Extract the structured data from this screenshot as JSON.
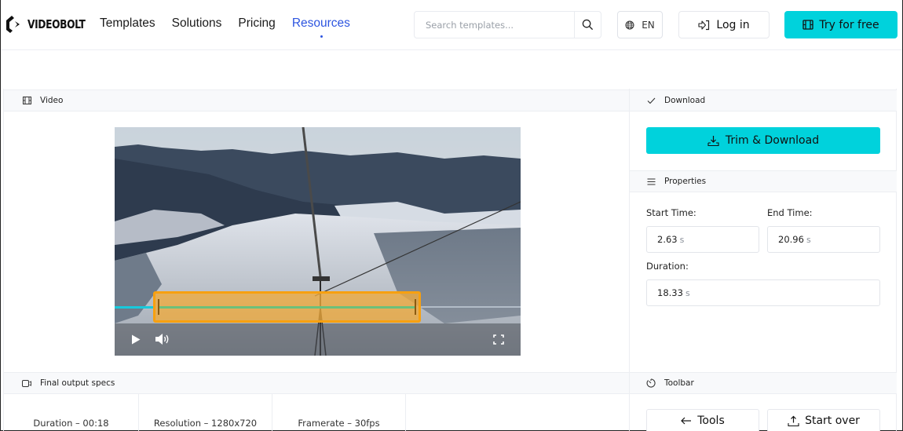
{
  "header": {
    "brand": "VIDEOBOLT",
    "nav": [
      {
        "label": "Templates",
        "active": false
      },
      {
        "label": "Solutions",
        "active": false
      },
      {
        "label": "Pricing",
        "active": false
      },
      {
        "label": "Resources",
        "active": true
      }
    ],
    "search": {
      "placeholder": "Search templates...",
      "value": "",
      "icon": "search-icon"
    },
    "language": {
      "label": "EN",
      "icon": "globe-icon"
    },
    "login": {
      "label": "Log in",
      "icon": "login-icon"
    },
    "try_free": {
      "label": "Try for free",
      "icon": "film-icon"
    }
  },
  "video_panel": {
    "title": "Video",
    "icon": "film-icon",
    "player": {
      "play_icon": "play-icon",
      "volume_icon": "volume-icon",
      "fullscreen_icon": "fullscreen-icon"
    },
    "trim": {
      "start_fraction": 0.095,
      "end_fraction": 0.755
    }
  },
  "download_panel": {
    "title": "Download",
    "icon": "check-icon",
    "button_label": "Trim & Download",
    "button_icon": "download-icon"
  },
  "properties_panel": {
    "title": "Properties",
    "icon": "menu-icon",
    "start_time": {
      "label": "Start Time:",
      "value": "2.63",
      "unit": "s"
    },
    "end_time": {
      "label": "End Time:",
      "value": "20.96",
      "unit": "s"
    },
    "duration": {
      "label": "Duration:",
      "value": "18.33",
      "unit": "s"
    }
  },
  "specs_panel": {
    "title": "Final output specs",
    "icon": "video-camera-icon",
    "items": [
      {
        "label": "Duration – 00:18"
      },
      {
        "label": "Resolution – 1280x720"
      },
      {
        "label": "Framerate – 30fps"
      }
    ]
  },
  "toolbar_panel": {
    "title": "Toolbar",
    "icon": "timer-icon",
    "buttons": [
      {
        "label": "Tools",
        "icon": "arrow-left-icon"
      },
      {
        "label": "Start over",
        "icon": "upload-icon"
      }
    ]
  },
  "colors": {
    "accent": "#00d2dc",
    "nav_active": "#2d55e0",
    "trim_border": "#f7a010",
    "trim_fill": "#f0aa3c",
    "progress": "#6cc07a",
    "track": "#18c9dc"
  }
}
